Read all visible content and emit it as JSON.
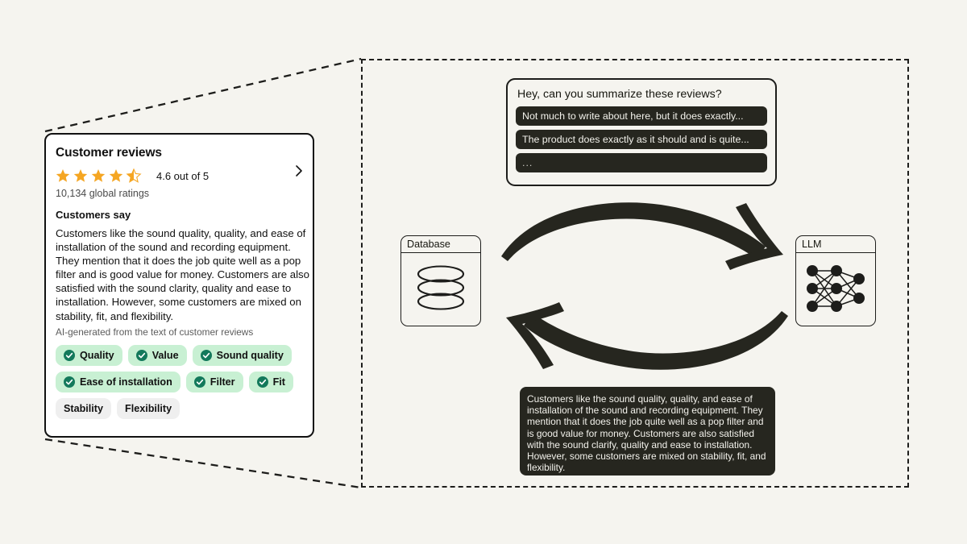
{
  "canvas": {
    "background_color": "#f5f4ef"
  },
  "review_card": {
    "title": "Customer reviews",
    "rating_value": "4.6 out of 5",
    "stars_filled": 4.5,
    "star_color": "#f5a623",
    "global_ratings": "10,134 global ratings",
    "customers_say_heading": "Customers say",
    "summary": "Customers like the sound quality, quality, and ease of installation of the sound and recording equipment. They mention that it does the job quite well as a pop filter and is good value for money. Customers are also satisfied with the sound clarity, quality and ease to installation. However, some customers are mixed on stability, fit, and flexibility.",
    "ai_note": "AI-generated from the text of customer reviews",
    "chevron_icon": "chevron-right-icon",
    "chip_rows": [
      [
        {
          "label": "Quality",
          "type": "positive"
        },
        {
          "label": "Value",
          "type": "positive"
        },
        {
          "label": "Sound quality",
          "type": "positive"
        }
      ],
      [
        {
          "label": "Ease of installation",
          "type": "positive"
        },
        {
          "label": "Filter",
          "type": "positive"
        },
        {
          "label": "Fit",
          "type": "positive"
        }
      ],
      [
        {
          "label": "Stability",
          "type": "neutral"
        },
        {
          "label": "Flexibility",
          "type": "neutral"
        }
      ]
    ],
    "chip_positive_bg": "#c8f0d3",
    "chip_neutral_bg": "#efefef",
    "chip_check_color": "#13795b"
  },
  "prompt_box": {
    "question": "Hey, can you summarize these reviews?",
    "reviews": [
      "Not much to write about here, but it does exactly...",
      "The product does exactly as it should and is quite...",
      "..."
    ]
  },
  "nodes": {
    "database": {
      "label": "Database",
      "icon": "database-cylinder-icon"
    },
    "llm": {
      "label": "LLM",
      "icon": "neural-network-icon"
    }
  },
  "arrows": {
    "top": {
      "direction": "database-to-llm",
      "color": "#26261f"
    },
    "bottom": {
      "direction": "llm-to-database",
      "color": "#26261f"
    }
  },
  "output_box": {
    "text": "Customers like the sound quality, quality, and ease of installation of the sound and recording equipment. They mention that it does the job quite well as a pop filter and is good value for money. Customers are also satisfied with the sound clarify, quality and ease to installation. However, some customers are mixed on stability, fit, and flexibility.",
    "background_color": "#26261f",
    "text_color": "#f3f2ec"
  }
}
